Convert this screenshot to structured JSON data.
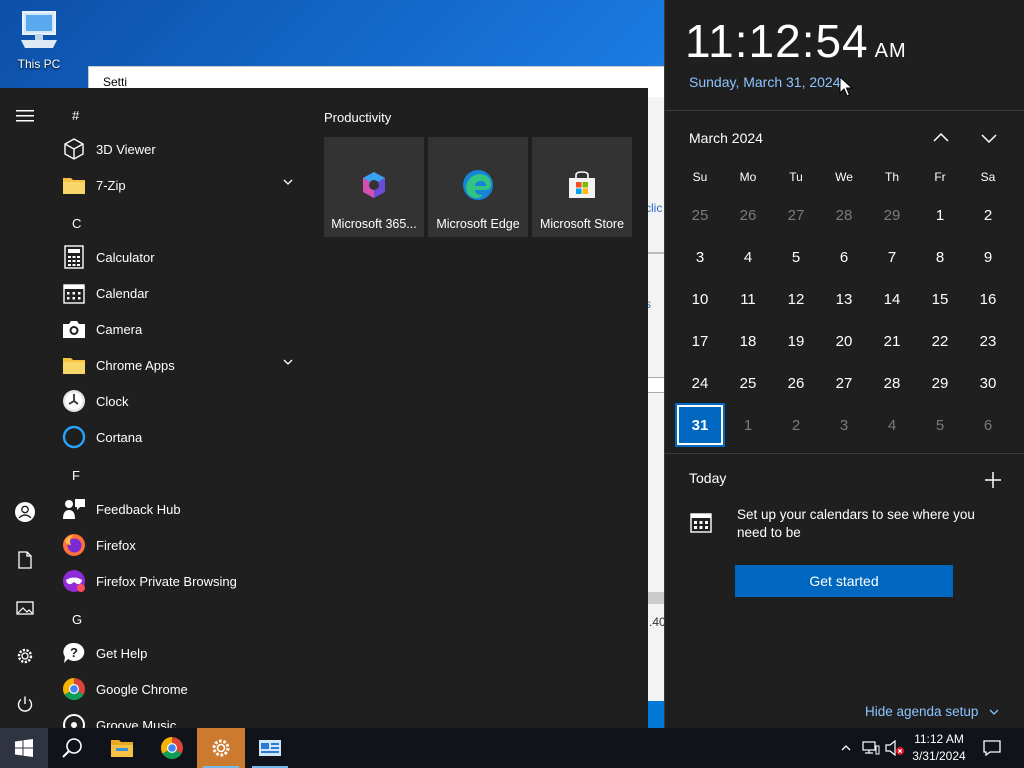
{
  "desktop": {
    "icon_label": "This PC"
  },
  "background_window": {
    "title_fragment": "Setti",
    "fragments": [
      "clic",
      "s",
      ".40"
    ]
  },
  "start_menu": {
    "apps": [
      {
        "type": "letter",
        "text": "#"
      },
      {
        "type": "app",
        "label": "3D Viewer",
        "icon": "cube-icon"
      },
      {
        "type": "app",
        "label": "7-Zip",
        "icon": "folder-icon",
        "expandable": true
      },
      {
        "type": "letter",
        "text": "C"
      },
      {
        "type": "app",
        "label": "Calculator",
        "icon": "calculator-icon"
      },
      {
        "type": "app",
        "label": "Calendar",
        "icon": "calendar-icon"
      },
      {
        "type": "app",
        "label": "Camera",
        "icon": "camera-icon"
      },
      {
        "type": "app",
        "label": "Chrome Apps",
        "icon": "folder-icon",
        "expandable": true
      },
      {
        "type": "app",
        "label": "Clock",
        "icon": "clock-icon"
      },
      {
        "type": "app",
        "label": "Cortana",
        "icon": "cortana-icon"
      },
      {
        "type": "letter",
        "text": "F"
      },
      {
        "type": "app",
        "label": "Feedback Hub",
        "icon": "feedback-icon"
      },
      {
        "type": "app",
        "label": "Firefox",
        "icon": "firefox-icon"
      },
      {
        "type": "app",
        "label": "Firefox Private Browsing",
        "icon": "firefox-private-icon"
      },
      {
        "type": "letter",
        "text": "G"
      },
      {
        "type": "app",
        "label": "Get Help",
        "icon": "help-icon"
      },
      {
        "type": "app",
        "label": "Google Chrome",
        "icon": "chrome-icon"
      },
      {
        "type": "app",
        "label": "Groove Music",
        "icon": "groove-icon"
      }
    ],
    "tiles_heading": "Productivity",
    "tiles": [
      {
        "label": "Microsoft 365...",
        "icon": "m365-icon"
      },
      {
        "label": "Microsoft Edge",
        "icon": "edge-icon"
      },
      {
        "label": "Microsoft Store",
        "icon": "store-icon"
      }
    ]
  },
  "flyout": {
    "time": "11:12:54",
    "ampm": "AM",
    "date_long": "Sunday, March 31, 2024",
    "month_label": "March 2024",
    "weekdays": [
      "Su",
      "Mo",
      "Tu",
      "We",
      "Th",
      "Fr",
      "Sa"
    ],
    "weeks": [
      [
        "25",
        "26",
        "27",
        "28",
        "29",
        "1",
        "2"
      ],
      [
        "3",
        "4",
        "5",
        "6",
        "7",
        "8",
        "9"
      ],
      [
        "10",
        "11",
        "12",
        "13",
        "14",
        "15",
        "16"
      ],
      [
        "17",
        "18",
        "19",
        "20",
        "21",
        "22",
        "23"
      ],
      [
        "24",
        "25",
        "26",
        "27",
        "28",
        "29",
        "30"
      ],
      [
        "31",
        "1",
        "2",
        "3",
        "4",
        "5",
        "6"
      ]
    ],
    "today_heading": "Today",
    "setup_text": "Set up your calendars to see where you need to be",
    "get_started": "Get started",
    "hide_agenda": "Hide agenda setup"
  },
  "taskbar": {
    "time": "11:12 AM",
    "date": "3/31/2024"
  },
  "colors": {
    "accent": "#0067c0",
    "link": "#8cc4ff",
    "panel": "#1f1f1f",
    "taskbar": "#10131a"
  }
}
